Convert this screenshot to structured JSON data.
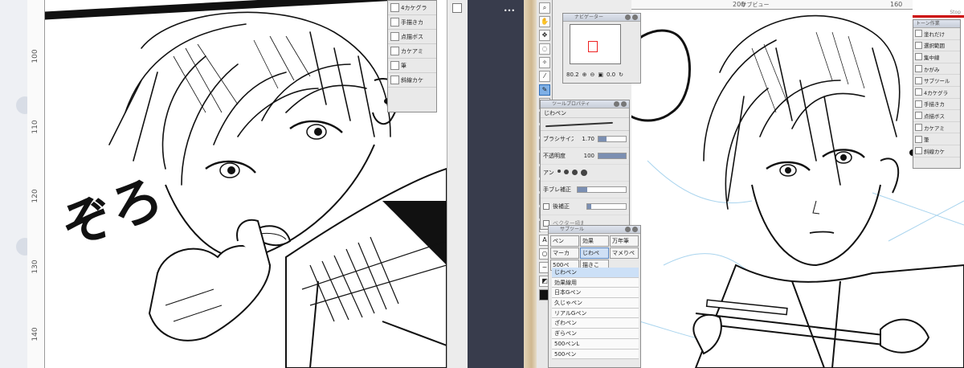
{
  "left_window": {
    "ruler_ticks": [
      "100",
      "110",
      "120",
      "130",
      "140"
    ],
    "sfx_text": "ぞろ",
    "sub_tool_rows": [
      {
        "label": "4カケグラ",
        "icon": "brush-stripes-icon"
      },
      {
        "label": "手描きカ",
        "icon": "hatching-brush-icon"
      },
      {
        "label": "点描ボス",
        "icon": "stipple-brush-icon"
      },
      {
        "label": "カケアミ",
        "icon": "crosshatch-icon"
      },
      {
        "label": "筆",
        "icon": "brush-icon"
      },
      {
        "label": "斜線カケ",
        "icon": "diagonal-hatch-icon"
      }
    ]
  },
  "divider": {
    "more_label": "•••"
  },
  "right_window": {
    "top_ruler": [
      "200",
      "160"
    ],
    "canvas_title": "サブビュー",
    "navigator": {
      "title": "ナビゲーター",
      "zoom_value": "80.2",
      "rotate_value": "0.0"
    },
    "tool_property": {
      "title": "ツールプロパティ",
      "tool_name": "じわペン",
      "brush_size_label": "ブラシサイズ",
      "brush_size_value": "1.70",
      "opacity_label": "不透明度",
      "opacity_value": "100",
      "anti_alias_label": "アン",
      "stabilization_label": "手ブレ補正",
      "post_correction_label": "後補正",
      "vector_label": "ベクター吸着"
    },
    "sub_tool": {
      "title": "サブツール",
      "tabs": [
        {
          "label": "ペン",
          "selected": false
        },
        {
          "label": "効果",
          "selected": false
        },
        {
          "label": "万年筆",
          "selected": false
        },
        {
          "label": "マーカ",
          "selected": false
        },
        {
          "label": "じわペ",
          "selected": true
        },
        {
          "label": "マメりペ",
          "selected": false
        },
        {
          "label": "500ペ",
          "selected": false
        },
        {
          "label": "描きこ",
          "selected": false
        }
      ],
      "list": [
        "じわペン",
        "効果線用",
        "日本Gペン",
        "久じゃペン",
        "リアルGペン",
        "ざわペン",
        "ぎらペン",
        "500ペンL",
        "500ペン"
      ],
      "selected_index": 0
    },
    "tone_palette": {
      "title": "トーン作業",
      "bar_label": "Stop",
      "rows": [
        {
          "label": "塗れだけ",
          "icon": "fill-icon"
        },
        {
          "label": "選択範囲",
          "icon": "selection-icon"
        },
        {
          "label": "集中線",
          "icon": "focus-lines-icon"
        },
        {
          "label": "かがみ",
          "icon": "mirror-icon"
        },
        {
          "label": "サブツール",
          "icon": "subtool-icon"
        },
        {
          "label": "4カケグラ",
          "icon": "brush-stripes-icon"
        },
        {
          "label": "手描きカ",
          "icon": "hatching-brush-icon"
        },
        {
          "label": "点描ボス",
          "icon": "stipple-brush-icon"
        },
        {
          "label": "カケアミ",
          "icon": "crosshatch-icon"
        },
        {
          "label": "筆",
          "icon": "brush-icon"
        },
        {
          "label": "斜線カケ",
          "icon": "diagonal-hatch-icon"
        }
      ]
    }
  }
}
